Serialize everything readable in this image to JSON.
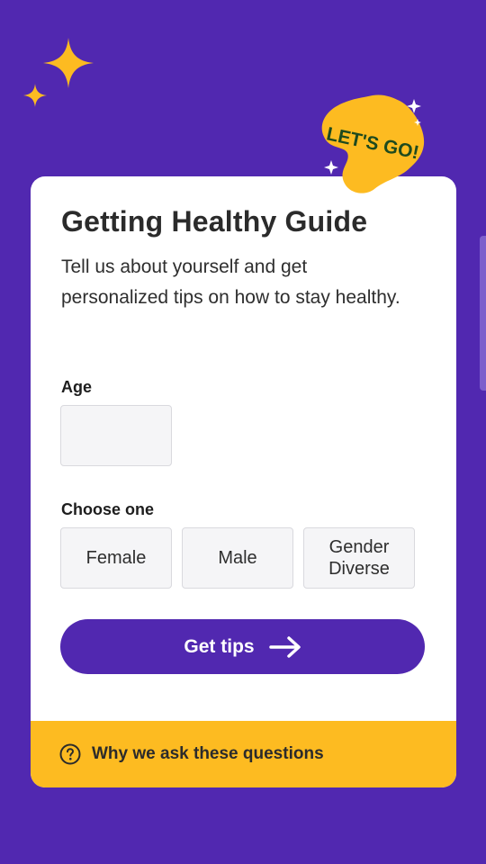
{
  "colors": {
    "background": "#5128b0",
    "accent_yellow": "#fdbb21",
    "card": "#ffffff",
    "button": "#5128b0"
  },
  "badge": {
    "text": "LET'S GO!"
  },
  "form": {
    "title": "Getting Healthy Guide",
    "subtitle": "Tell us about yourself and get personalized tips on how to stay healthy.",
    "age_label": "Age",
    "age_value": "",
    "choose_label": "Choose one",
    "options": [
      "Female",
      "Male",
      "Gender Diverse"
    ],
    "submit_label": "Get tips",
    "submit_icon": "arrow-right-icon"
  },
  "footer": {
    "icon": "question-circle-icon",
    "text": "Why we ask these questions"
  }
}
